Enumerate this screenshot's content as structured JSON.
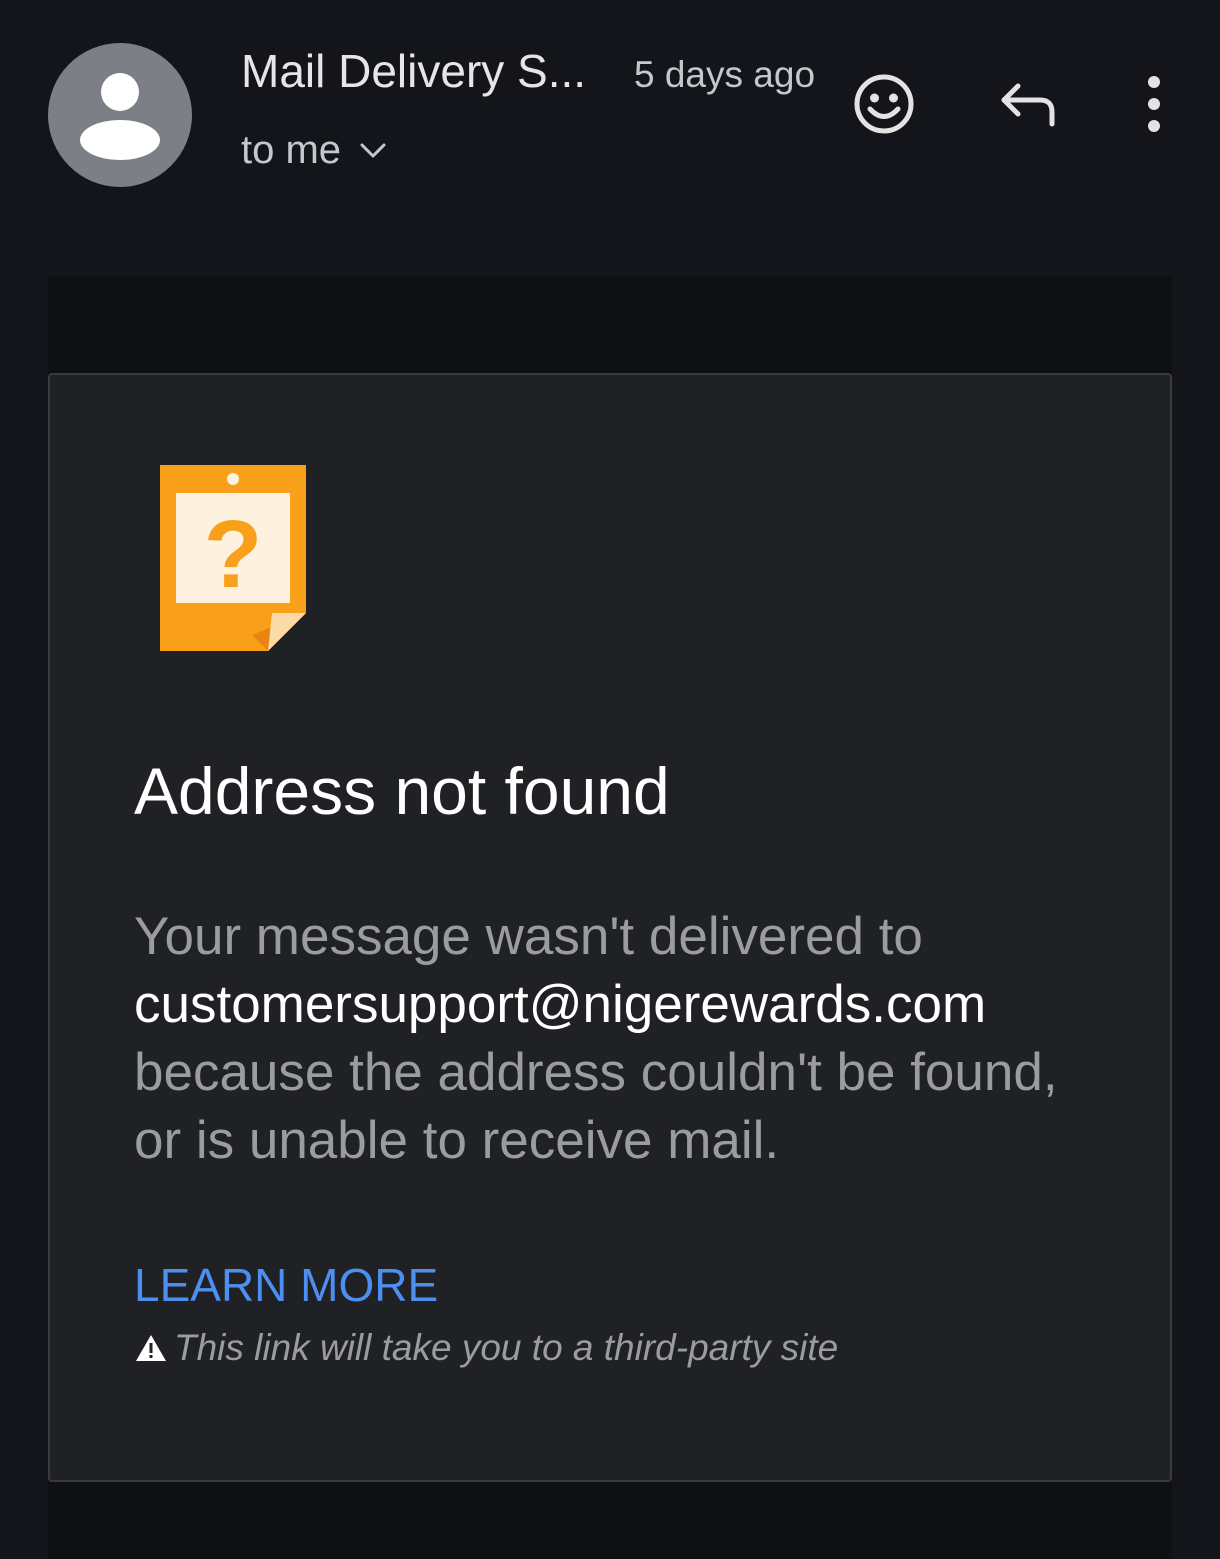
{
  "header": {
    "sender_name": "Mail Delivery S...",
    "time_ago": "5 days ago",
    "recipient_label": "to me"
  },
  "icons": {
    "avatar": "person-icon",
    "recipients_toggle": "chevron-down-icon",
    "react": "emoji-icon",
    "reply": "reply-icon",
    "more": "more-vert-icon",
    "bounce": "question-note-icon",
    "warning": "warning-icon"
  },
  "message": {
    "title": "Address not found",
    "body_prefix": "Your message wasn't delivered to",
    "address": "customersupport@nigerewards.com",
    "body_suffix": "because the address couldn't be found, or is unable to receive mail.",
    "learn_more": "LEARN MORE",
    "warning": "This link will take you to a third-party site"
  },
  "colors": {
    "background": "#13151a",
    "card": "#202124",
    "link": "#4d8ff0",
    "icon_orange": "#f5a623"
  }
}
